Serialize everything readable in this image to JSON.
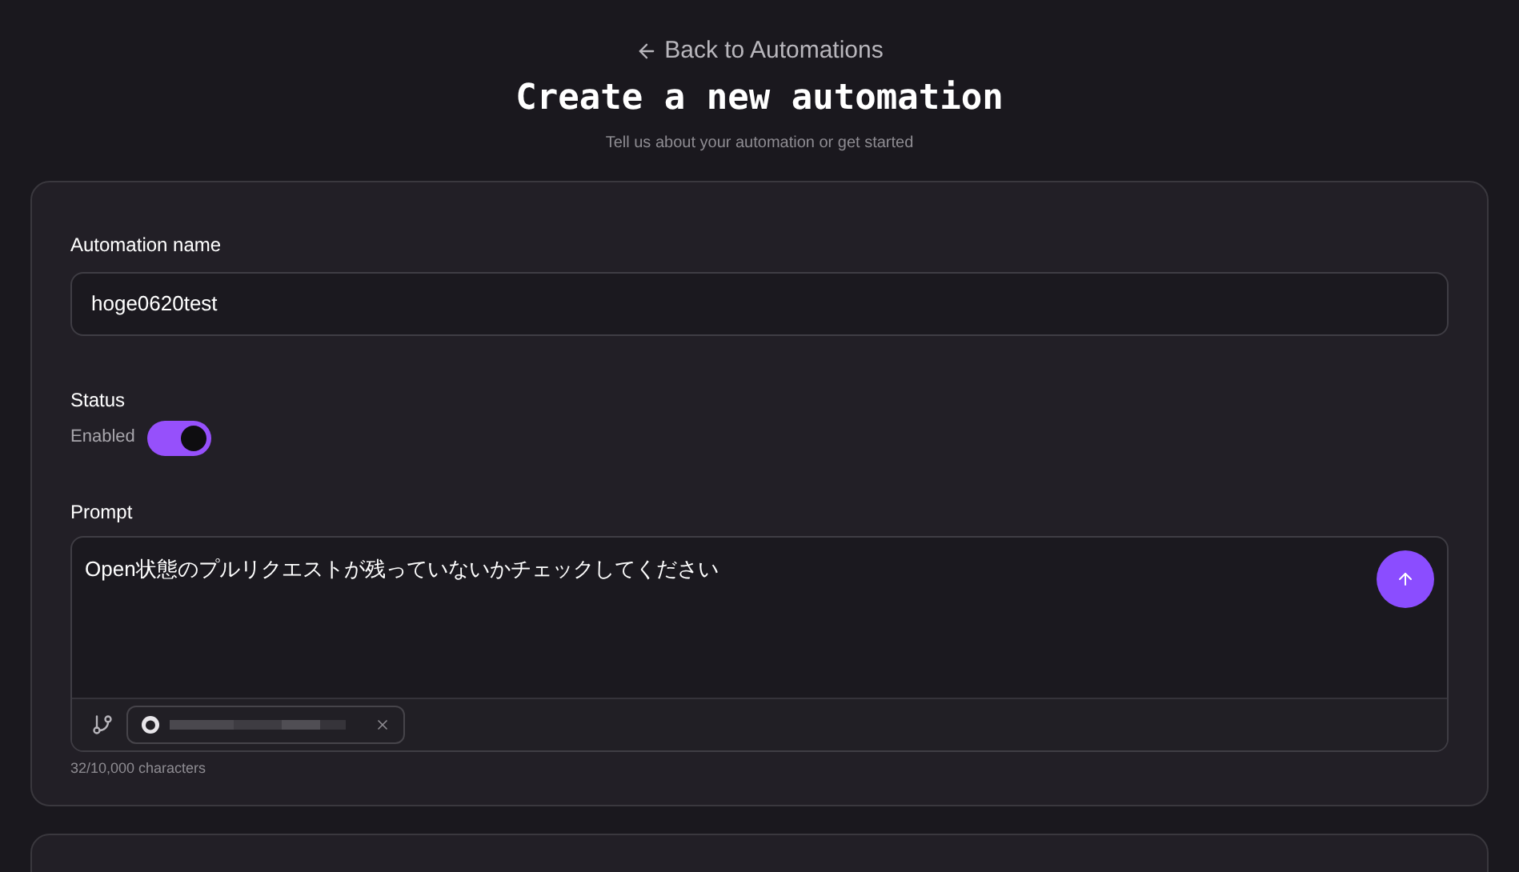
{
  "back_link": "Back to Automations",
  "title": "Create a new automation",
  "subtitle": "Tell us about your automation or get started",
  "name_field": {
    "label": "Automation name",
    "value": "hoge0620test"
  },
  "status": {
    "label": "Status",
    "toggle_label": "Enabled",
    "on": true
  },
  "prompt": {
    "label": "Prompt",
    "value": "Open状態のプルリクエストが残っていないかチェックしてください",
    "counter": "32/10,000 characters"
  }
}
